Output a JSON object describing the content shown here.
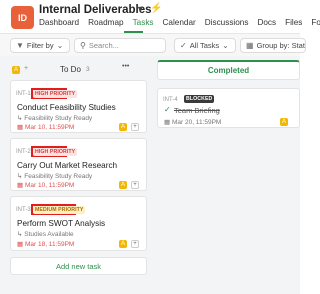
{
  "header": {
    "avatar_initials": "ID",
    "project_title": "Internal Deliverables",
    "nav": [
      {
        "label": "Dashboard"
      },
      {
        "label": "Roadmap"
      },
      {
        "label": "Tasks"
      },
      {
        "label": "Calendar"
      },
      {
        "label": "Discussions"
      },
      {
        "label": "Docs"
      },
      {
        "label": "Files"
      },
      {
        "label": "Forma"
      }
    ],
    "active_nav": "Tasks"
  },
  "toolbar": {
    "filter_label": "Filter by",
    "search_placeholder": "Search...",
    "all_tasks_label": "All Tasks",
    "group_by_label": "Group by: Status"
  },
  "columns": [
    {
      "title": "To Do",
      "count": "3",
      "more": "•••",
      "add_task_label": "Add new task",
      "cards": [
        {
          "id": "INT-1",
          "priority": "HIGH PRIORITY",
          "title": "Conduct Feasibility Studies",
          "subtitle": "Feasibility Study Ready",
          "date": "Mar 10, 11:59PM",
          "badge_letter": "A"
        },
        {
          "id": "INT-2",
          "priority": "HIGH PRIORITY",
          "title": "Carry Out Market Research",
          "subtitle": "Feasibility Study Ready",
          "date": "Mar 10, 11:59PM",
          "badge_letter": "A"
        },
        {
          "id": "INT-3",
          "priority": "MEDIUM PRIORITY",
          "title": "Perform SWOT Analysis",
          "subtitle": "Studies Available",
          "date": "Mar 18, 11:59PM",
          "badge_letter": "A"
        }
      ]
    },
    {
      "title": "Completed",
      "cards": [
        {
          "id": "INT-4",
          "status": "BLOCKED",
          "title": "Team Briefing",
          "date": "Mar 20, 11:59PM",
          "badge_letter": "A"
        }
      ]
    }
  ],
  "colors": {
    "accent": "#2f8f4e",
    "high_priority": "#d23b3b",
    "medium_priority": "#a86a00",
    "highlight": "#e31c1c",
    "avatar": "#e8613a"
  }
}
